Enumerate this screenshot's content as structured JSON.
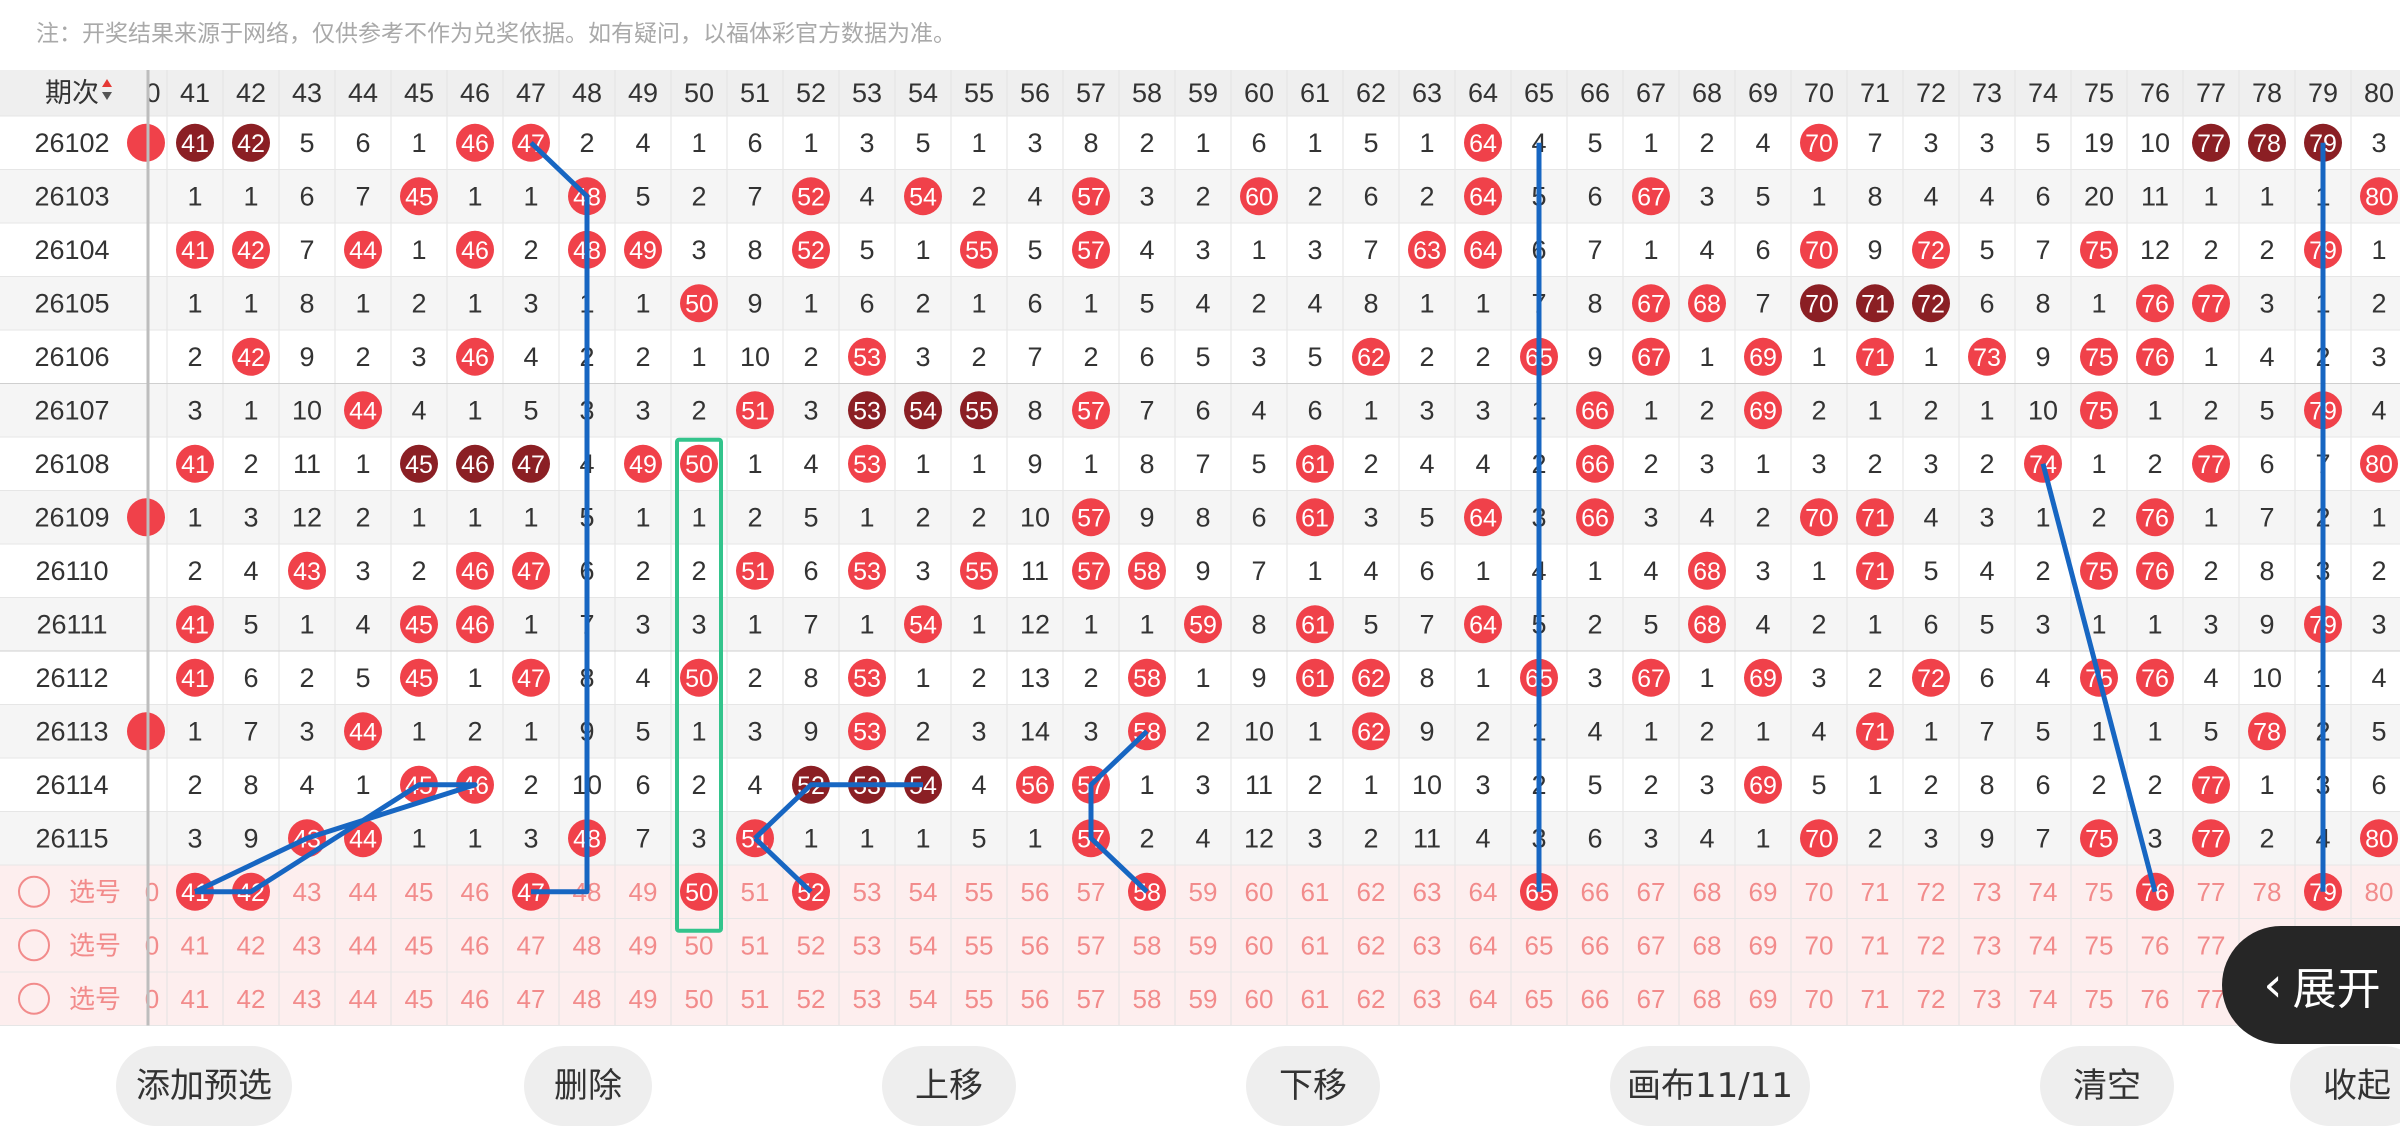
{
  "notice": "注：开奖结果来源于网络，仅供参考不作为兑奖依据。如有疑问，以福体彩官方数据为准。",
  "header": {
    "issue_label": "期次",
    "sort_icon": "sort-up-down-icon",
    "partial_left_digit": "0",
    "columns": [
      "41",
      "42",
      "43",
      "44",
      "45",
      "46",
      "47",
      "48",
      "49",
      "50",
      "51",
      "52",
      "53",
      "54",
      "55",
      "56",
      "57",
      "58",
      "59",
      "60",
      "61",
      "62",
      "63",
      "64",
      "65",
      "66",
      "67",
      "68",
      "69",
      "70",
      "71",
      "72",
      "73",
      "74",
      "75",
      "76",
      "77",
      "78",
      "79",
      "80"
    ]
  },
  "rows": [
    {
      "issue": "26102",
      "left": "0",
      "cells": [
        "41",
        "42",
        "5",
        "6",
        "1",
        "46",
        "47",
        "2",
        "4",
        "1",
        "6",
        "1",
        "3",
        "5",
        "1",
        "3",
        "8",
        "2",
        "1",
        "6",
        "1",
        "5",
        "1",
        "64",
        "4",
        "5",
        "1",
        "2",
        "4",
        "70",
        "7",
        "3",
        "3",
        "5",
        "19",
        "10",
        "77",
        "78",
        "79",
        "3"
      ]
    },
    {
      "issue": "26103",
      "left": "",
      "cells": [
        "1",
        "1",
        "6",
        "7",
        "45",
        "1",
        "1",
        "48",
        "5",
        "2",
        "7",
        "52",
        "4",
        "54",
        "2",
        "4",
        "57",
        "3",
        "2",
        "60",
        "2",
        "6",
        "2",
        "64",
        "5",
        "6",
        "67",
        "3",
        "5",
        "1",
        "8",
        "4",
        "4",
        "6",
        "20",
        "11",
        "1",
        "1",
        "1",
        "80"
      ]
    },
    {
      "issue": "26104",
      "left": "",
      "cells": [
        "41",
        "42",
        "7",
        "44",
        "1",
        "46",
        "2",
        "48",
        "49",
        "3",
        "8",
        "52",
        "5",
        "1",
        "55",
        "5",
        "57",
        "4",
        "3",
        "1",
        "3",
        "7",
        "63",
        "64",
        "6",
        "7",
        "1",
        "4",
        "6",
        "70",
        "9",
        "72",
        "5",
        "7",
        "75",
        "12",
        "2",
        "2",
        "79",
        "1"
      ]
    },
    {
      "issue": "26105",
      "left": "",
      "cells": [
        "1",
        "1",
        "8",
        "1",
        "2",
        "1",
        "3",
        "1",
        "1",
        "50",
        "9",
        "1",
        "6",
        "2",
        "1",
        "6",
        "1",
        "5",
        "4",
        "2",
        "4",
        "8",
        "1",
        "1",
        "7",
        "8",
        "67",
        "68",
        "7",
        "70",
        "71",
        "72",
        "6",
        "8",
        "1",
        "76",
        "77",
        "3",
        "1",
        "2"
      ]
    },
    {
      "issue": "26106",
      "left": "",
      "cells": [
        "2",
        "42",
        "9",
        "2",
        "3",
        "46",
        "4",
        "2",
        "2",
        "1",
        "10",
        "2",
        "53",
        "3",
        "2",
        "7",
        "2",
        "6",
        "5",
        "3",
        "5",
        "62",
        "2",
        "2",
        "65",
        "9",
        "67",
        "1",
        "69",
        "1",
        "71",
        "1",
        "73",
        "9",
        "75",
        "76",
        "1",
        "4",
        "2",
        "3"
      ]
    },
    {
      "issue": "26107",
      "left": "",
      "cells": [
        "3",
        "1",
        "10",
        "44",
        "4",
        "1",
        "5",
        "3",
        "3",
        "2",
        "51",
        "3",
        "53",
        "54",
        "55",
        "8",
        "57",
        "7",
        "6",
        "4",
        "6",
        "1",
        "3",
        "3",
        "1",
        "66",
        "1",
        "2",
        "69",
        "2",
        "1",
        "2",
        "1",
        "10",
        "75",
        "1",
        "2",
        "5",
        "79",
        "4"
      ]
    },
    {
      "issue": "26108",
      "left": "",
      "cells": [
        "41",
        "2",
        "11",
        "1",
        "45",
        "46",
        "47",
        "4",
        "49",
        "50",
        "1",
        "4",
        "53",
        "1",
        "1",
        "9",
        "1",
        "8",
        "7",
        "5",
        "61",
        "2",
        "4",
        "4",
        "2",
        "66",
        "2",
        "3",
        "1",
        "3",
        "2",
        "3",
        "2",
        "74",
        "1",
        "2",
        "77",
        "6",
        "7",
        "80"
      ]
    },
    {
      "issue": "26109",
      "left": "0",
      "cells": [
        "1",
        "3",
        "12",
        "2",
        "1",
        "1",
        "1",
        "5",
        "1",
        "1",
        "2",
        "5",
        "1",
        "2",
        "2",
        "10",
        "57",
        "9",
        "8",
        "6",
        "61",
        "3",
        "5",
        "64",
        "3",
        "66",
        "3",
        "4",
        "2",
        "70",
        "71",
        "4",
        "3",
        "1",
        "2",
        "76",
        "1",
        "7",
        "2",
        "1"
      ]
    },
    {
      "issue": "26110",
      "left": "",
      "cells": [
        "2",
        "4",
        "43",
        "3",
        "2",
        "46",
        "47",
        "6",
        "2",
        "2",
        "51",
        "6",
        "53",
        "3",
        "55",
        "11",
        "57",
        "58",
        "9",
        "7",
        "1",
        "4",
        "6",
        "1",
        "4",
        "1",
        "4",
        "68",
        "3",
        "1",
        "71",
        "5",
        "4",
        "2",
        "75",
        "76",
        "2",
        "8",
        "3",
        "2"
      ]
    },
    {
      "issue": "26111",
      "left": "",
      "cells": [
        "41",
        "5",
        "1",
        "4",
        "45",
        "46",
        "1",
        "7",
        "3",
        "3",
        "1",
        "7",
        "1",
        "54",
        "1",
        "12",
        "1",
        "1",
        "59",
        "8",
        "61",
        "5",
        "7",
        "64",
        "5",
        "2",
        "5",
        "68",
        "4",
        "2",
        "1",
        "6",
        "5",
        "3",
        "1",
        "1",
        "3",
        "9",
        "79",
        "3"
      ]
    },
    {
      "issue": "26112",
      "left": "",
      "cells": [
        "41",
        "6",
        "2",
        "5",
        "45",
        "1",
        "47",
        "8",
        "4",
        "50",
        "2",
        "8",
        "53",
        "1",
        "2",
        "13",
        "2",
        "58",
        "1",
        "9",
        "61",
        "62",
        "8",
        "1",
        "65",
        "3",
        "67",
        "1",
        "69",
        "3",
        "2",
        "72",
        "6",
        "4",
        "75",
        "76",
        "4",
        "10",
        "1",
        "4"
      ]
    },
    {
      "issue": "26113",
      "left": "0",
      "cells": [
        "1",
        "7",
        "3",
        "44",
        "1",
        "2",
        "1",
        "9",
        "5",
        "1",
        "3",
        "9",
        "53",
        "2",
        "3",
        "14",
        "3",
        "58",
        "2",
        "10",
        "1",
        "62",
        "9",
        "2",
        "1",
        "4",
        "1",
        "2",
        "1",
        "4",
        "71",
        "1",
        "7",
        "5",
        "1",
        "1",
        "5",
        "78",
        "2",
        "5"
      ]
    },
    {
      "issue": "26114",
      "left": "",
      "cells": [
        "2",
        "8",
        "4",
        "1",
        "45",
        "46",
        "2",
        "10",
        "6",
        "2",
        "4",
        "52",
        "53",
        "54",
        "4",
        "56",
        "57",
        "1",
        "3",
        "11",
        "2",
        "1",
        "10",
        "3",
        "2",
        "5",
        "2",
        "3",
        "69",
        "5",
        "1",
        "2",
        "8",
        "6",
        "2",
        "2",
        "77",
        "1",
        "3",
        "6"
      ]
    },
    {
      "issue": "26115",
      "left": "",
      "cells": [
        "3",
        "9",
        "43",
        "44",
        "1",
        "1",
        "3",
        "48",
        "7",
        "3",
        "51",
        "1",
        "1",
        "1",
        "5",
        "1",
        "57",
        "2",
        "4",
        "12",
        "3",
        "2",
        "11",
        "4",
        "3",
        "6",
        "3",
        "4",
        "1",
        "70",
        "2",
        "3",
        "9",
        "7",
        "75",
        "3",
        "77",
        "2",
        "4",
        "80"
      ]
    }
  ],
  "select_rows": [
    {
      "label": "选号",
      "left": "0",
      "cells": [
        "41",
        "42",
        "43",
        "44",
        "45",
        "46",
        "47",
        "48",
        "49",
        "50",
        "51",
        "52",
        "53",
        "54",
        "55",
        "56",
        "57",
        "58",
        "59",
        "60",
        "61",
        "62",
        "63",
        "64",
        "65",
        "66",
        "67",
        "68",
        "69",
        "70",
        "71",
        "72",
        "73",
        "74",
        "75",
        "76",
        "77",
        "78",
        "79",
        "80"
      ]
    },
    {
      "label": "选号",
      "left": "0",
      "cells": [
        "41",
        "42",
        "43",
        "44",
        "45",
        "46",
        "47",
        "48",
        "49",
        "50",
        "51",
        "52",
        "53",
        "54",
        "55",
        "56",
        "57",
        "58",
        "59",
        "60",
        "61",
        "62",
        "63",
        "64",
        "65",
        "66",
        "67",
        "68",
        "69",
        "70",
        "71",
        "72",
        "73",
        "74",
        "75",
        "76",
        "77",
        "78",
        "79",
        "80"
      ]
    },
    {
      "label": "选号",
      "left": "0",
      "cells": [
        "41",
        "42",
        "43",
        "44",
        "45",
        "46",
        "47",
        "48",
        "49",
        "50",
        "51",
        "52",
        "53",
        "54",
        "55",
        "56",
        "57",
        "58",
        "59",
        "60",
        "61",
        "62",
        "63",
        "64",
        "65",
        "66",
        "67",
        "68",
        "69",
        "70",
        "71",
        "72",
        "73",
        "74",
        "75",
        "76",
        "77",
        "78",
        "79",
        "80"
      ]
    }
  ],
  "dark_balls": [
    [
      "26102",
      "41"
    ],
    [
      "26102",
      "42"
    ],
    [
      "26102",
      "77"
    ],
    [
      "26102",
      "78"
    ],
    [
      "26102",
      "79"
    ],
    [
      "26105",
      "70"
    ],
    [
      "26105",
      "71"
    ],
    [
      "26105",
      "72"
    ],
    [
      "26107",
      "53"
    ],
    [
      "26107",
      "54"
    ],
    [
      "26107",
      "55"
    ],
    [
      "26108",
      "45"
    ],
    [
      "26108",
      "46"
    ],
    [
      "26108",
      "47"
    ],
    [
      "26114",
      "52"
    ],
    [
      "26114",
      "53"
    ],
    [
      "26114",
      "54"
    ]
  ],
  "selected_numbers": [
    "41",
    "42",
    "47",
    "50",
    "52",
    "58",
    "65",
    "76",
    "79"
  ],
  "expand_tab": {
    "label": "展开",
    "icon": "chevron-left-icon"
  },
  "bottom_buttons": [
    "添加预选",
    "删除",
    "上移",
    "下移",
    "画布11/11",
    "清空",
    "收起"
  ],
  "colors": {
    "ball_red": "#f0414a",
    "ball_dark": "#8b1f24",
    "line_blue": "#1766c2",
    "box_green": "#33c48c",
    "select_bg": "#fdeeee",
    "select_text": "#f28b8b",
    "header_bg": "#efefef",
    "stripe_bg": "#f5f5f5"
  }
}
